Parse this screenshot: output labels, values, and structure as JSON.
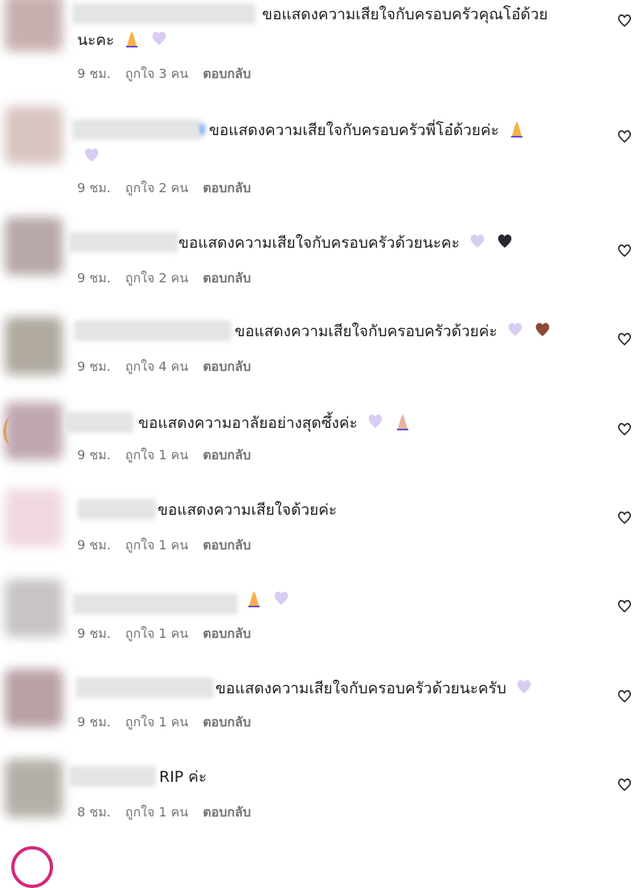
{
  "comments": [
    {
      "text": "ขอแสดงความเสียใจกับครอบครัวคุณโอ๋ด้วย",
      "text2": "นะคะ",
      "emojis": [
        "pray",
        "heart-purple"
      ],
      "time": "9 ชม.",
      "likes": "ถูกใจ 3 คน",
      "reply": "ตอบกลับ",
      "avatar_color": "#c8b0b0"
    },
    {
      "text": "ขอแสดงความเสียใจกับครอบครัวพี่โอ๋ด้วยค่ะ",
      "text2": "",
      "emojis": [
        "pray",
        "heart-purple"
      ],
      "time": "9 ชม.",
      "likes": "ถูกใจ 2 คน",
      "reply": "ตอบกลับ",
      "avatar_color": "#d8c4c0"
    },
    {
      "text": "ขอแสดงความเสียใจกับครอบครัวด้วยนะคะ",
      "text2": "",
      "emojis": [
        "heart-purple",
        "heart-black"
      ],
      "time": "9 ชม.",
      "likes": "ถูกใจ 2 คน",
      "reply": "ตอบกลับ",
      "avatar_color": "#b8a8a8"
    },
    {
      "text": "ขอแสดงความเสียใจกับครอบครัวด้วยค่ะ",
      "text2": "",
      "emojis": [
        "heart-purple",
        "heart-brown"
      ],
      "time": "9 ชม.",
      "likes": "ถูกใจ 4 คน",
      "reply": "ตอบกลับ",
      "avatar_color": "#b0aaa0"
    },
    {
      "text": "ขอแสดงความอาลัยอย่างสุดซึ้งค่ะ",
      "text2": "",
      "emojis": [
        "heart-purple",
        "pray"
      ],
      "time": "9 ชม.",
      "likes": "ถูกใจ 1 คน",
      "reply": "ตอบกลับ",
      "avatar_color": "#c0a8b0"
    },
    {
      "text": "ขอแสดงความเสียใจด้วยค่ะ",
      "text2": "",
      "emojis": [],
      "time": "9 ชม.",
      "likes": "ถูกใจ 1 คน",
      "reply": "ตอบกลับ",
      "avatar_color": "#f0d8e0"
    },
    {
      "text": "",
      "text2": "",
      "emojis": [
        "pray",
        "heart-purple"
      ],
      "time": "9 ชม.",
      "likes": "ถูกใจ 1 คน",
      "reply": "ตอบกลับ",
      "avatar_color": "#c8c4c4"
    },
    {
      "text": "ขอแสดงความเสียใจกับครอบครัวด้วยนะครับ",
      "text2": "",
      "emojis": [
        "heart-purple"
      ],
      "time": "9 ชม.",
      "likes": "ถูกใจ 1 คน",
      "reply": "ตอบกลับ",
      "avatar_color": "#b8a0a4"
    },
    {
      "text": "RIP ค่ะ",
      "text2": "",
      "emojis": [],
      "time": "8 ชม.",
      "likes": "ถูกใจ 1 คน",
      "reply": "ตอบกลับ",
      "avatar_color": "#b4b0a8"
    }
  ],
  "icons": {
    "like": "heart-outline-icon"
  }
}
